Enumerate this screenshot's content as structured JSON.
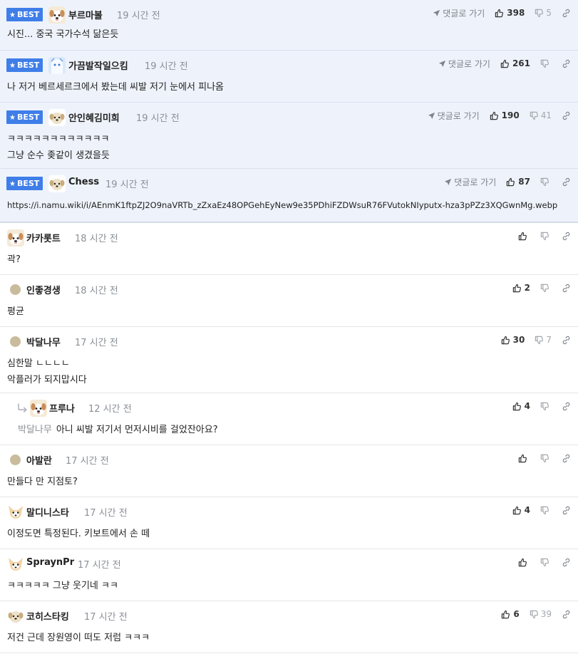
{
  "labels": {
    "best": "BEST",
    "goto": "댓글로 가기"
  },
  "colors": {
    "best_badge": "#3f7ee8",
    "best_bg": "#eef3fb",
    "muted": "#8b8f96"
  },
  "icons": {
    "thumbs_up": "thumbs-up-icon",
    "thumbs_down": "thumbs-down-icon",
    "link": "link-icon",
    "goto": "send-arrow-icon",
    "reply": "reply-arrow-icon"
  },
  "comments": [
    {
      "nick": "부르마볼",
      "time": "19 시간 전",
      "up": "398",
      "down": "5",
      "lines": [
        "시진... 중국 국가수석 닮은듯"
      ]
    },
    {
      "nick": "가끔발작일으킴",
      "time": "19 시간 전",
      "up": "261",
      "down": "",
      "lines": [
        "나 저거 베르세르크에서 봤는데 씨발 저기 눈에서 피나옴"
      ]
    },
    {
      "nick": "안인혜김미희",
      "time": "19 시간 전",
      "up": "190",
      "down": "41",
      "lines": [
        "ㅋㅋㅋㅋㅋㅋㅋㅋㅋㅋㅋㅋ",
        "그냥 순수 좆같이 생겼을듯"
      ]
    },
    {
      "nick": "Chess",
      "time": "19 시간 전",
      "up": "87",
      "down": "",
      "lines": [
        "https://i.namu.wiki/i/AEnmK1ftpZJ2O9naVRTb_zZxaEz48OPGehEyNew9e35PDhiFZDWsuR76FVutokNIyputx-hza3pPZz3XQGwnMg.webp"
      ]
    },
    {
      "nick": "카카롯트",
      "time": "18 시간 전",
      "up": "",
      "down": "",
      "lines": [
        "곽?"
      ]
    },
    {
      "nick": "인좋경생",
      "time": "18 시간 전",
      "up": "2",
      "down": "",
      "lines": [
        "평균"
      ]
    },
    {
      "nick": "박달나무",
      "time": "17 시간 전",
      "up": "30",
      "down": "7",
      "lines": [
        "심한말 ㄴㄴㄴㄴ",
        "악플러가 되지맙시다"
      ]
    },
    {
      "nick": "프루나",
      "time": "12 시간 전",
      "up": "4",
      "down": "",
      "mention": "박달나무",
      "lines": [
        "아니 씨발 저기서 먼저시비를 걸었잔아요?"
      ]
    },
    {
      "nick": "아발란",
      "time": "17 시간 전",
      "up": "",
      "down": "",
      "lines": [
        "만들다 만 지점토?"
      ]
    },
    {
      "nick": "말디니스타",
      "time": "17 시간 전",
      "up": "4",
      "down": "",
      "lines": [
        "이정도면 특정된다. 키보트에서 손 떼"
      ]
    },
    {
      "nick": "SpraynPr",
      "time": "17 시간 전",
      "up": "",
      "down": "",
      "lines": [
        "ㅋㅋㅋㅋㅋ 그냥 웃기네 ㅋㅋ"
      ]
    },
    {
      "nick": "코히스타킹",
      "time": "17 시간 전",
      "up": "6",
      "down": "39",
      "lines": [
        "저건 근데 장원영이 떠도 저럼 ㅋㅋㅋ"
      ]
    }
  ]
}
